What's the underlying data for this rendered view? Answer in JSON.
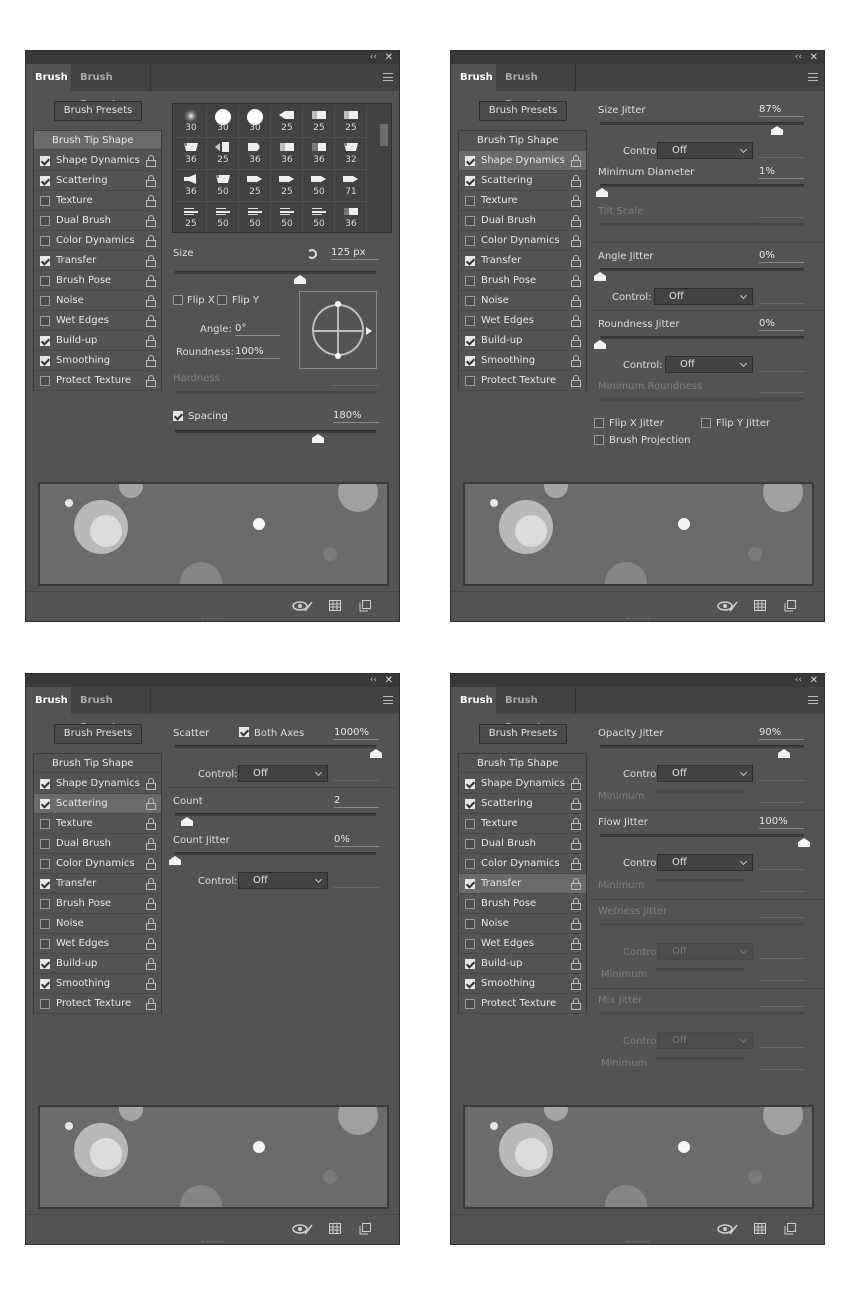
{
  "panels": [
    {
      "tab_active": "Brush",
      "tab_inactive": "Brush Presets"
    },
    {
      "tab_active": "Brush",
      "tab_inactive": "Brush Presets"
    },
    {
      "tab_active": "Brush",
      "tab_inactive": "Brush Presets"
    },
    {
      "tab_active": "Brush",
      "tab_inactive": "Brush Presets"
    }
  ],
  "common": {
    "presets_button": "Brush Presets",
    "tip_shape": "Brush Tip Shape",
    "collapse_glyph": "‹‹",
    "close_glyph": "✕",
    "items": [
      {
        "label": "Shape Dynamics"
      },
      {
        "label": "Scattering"
      },
      {
        "label": "Texture"
      },
      {
        "label": "Dual Brush"
      },
      {
        "label": "Color Dynamics"
      },
      {
        "label": "Transfer"
      },
      {
        "label": "Brush Pose"
      },
      {
        "label": "Noise"
      },
      {
        "label": "Wet Edges"
      },
      {
        "label": "Build-up"
      },
      {
        "label": "Smoothing"
      },
      {
        "label": "Protect Texture"
      }
    ],
    "checked": [
      true,
      true,
      false,
      false,
      false,
      true,
      false,
      false,
      false,
      true,
      true,
      false
    ],
    "icons": {
      "visibility": "eye-slash-icon",
      "grid": "grid-icon",
      "new": "new-preset-icon"
    }
  },
  "tip_panel": {
    "tip_sizes": [
      "30",
      "30",
      "30",
      "25",
      "25",
      "25",
      "36",
      "25",
      "36",
      "36",
      "36",
      "32",
      "36",
      "50",
      "25",
      "25",
      "50",
      "71",
      "25",
      "50",
      "50",
      "50",
      "50",
      "36"
    ],
    "size_label": "Size",
    "size_value": "125 px",
    "size_fraction": 0.62,
    "flip_x": "Flip X",
    "flip_y": "Flip Y",
    "angle_label": "Angle:",
    "angle_value": "0°",
    "roundness_label": "Roundness:",
    "roundness_value": "100%",
    "hardness_label": "Hardness",
    "spacing_label": "Spacing",
    "spacing_value": "180%",
    "spacing_fraction": 0.71
  },
  "shape_panel": {
    "size_jitter_label": "Size Jitter",
    "size_jitter_value": "87%",
    "size_jitter_fraction": 0.87,
    "control_label": "Control:",
    "control_value": "Off",
    "min_diameter_label": "Minimum Diameter",
    "min_diameter_value": "1%",
    "min_diameter_fraction": 0.01,
    "tilt_scale_label": "Tilt Scale",
    "angle_jitter_label": "Angle Jitter",
    "angle_jitter_value": "0%",
    "angle_jitter_fraction": 0.0,
    "roundness_jitter_label": "Roundness Jitter",
    "roundness_jitter_value": "0%",
    "roundness_jitter_fraction": 0.0,
    "min_roundness_label": "Minimum Roundness",
    "flip_x_jitter": "Flip X Jitter",
    "flip_y_jitter": "Flip Y Jitter",
    "brush_projection": "Brush Projection"
  },
  "scatter_panel": {
    "scatter_label": "Scatter",
    "both_axes": "Both Axes",
    "scatter_value": "1000%",
    "scatter_fraction": 1.0,
    "control_label": "Control:",
    "control_value": "Off",
    "count_label": "Count",
    "count_value": "2",
    "count_fraction": 0.06,
    "count_jitter_label": "Count Jitter",
    "count_jitter_value": "0%",
    "count_jitter_fraction": 0.0
  },
  "transfer_panel": {
    "opacity_jitter_label": "Opacity Jitter",
    "opacity_jitter_value": "90%",
    "opacity_jitter_fraction": 0.9,
    "control_label": "Control:",
    "control_value": "Off",
    "minimum_label": "Minimum",
    "flow_jitter_label": "Flow Jitter",
    "flow_jitter_value": "100%",
    "flow_jitter_fraction": 1.0,
    "wetness_jitter_label": "Wetness Jitter",
    "mix_jitter_label": "Mix Jitter"
  }
}
